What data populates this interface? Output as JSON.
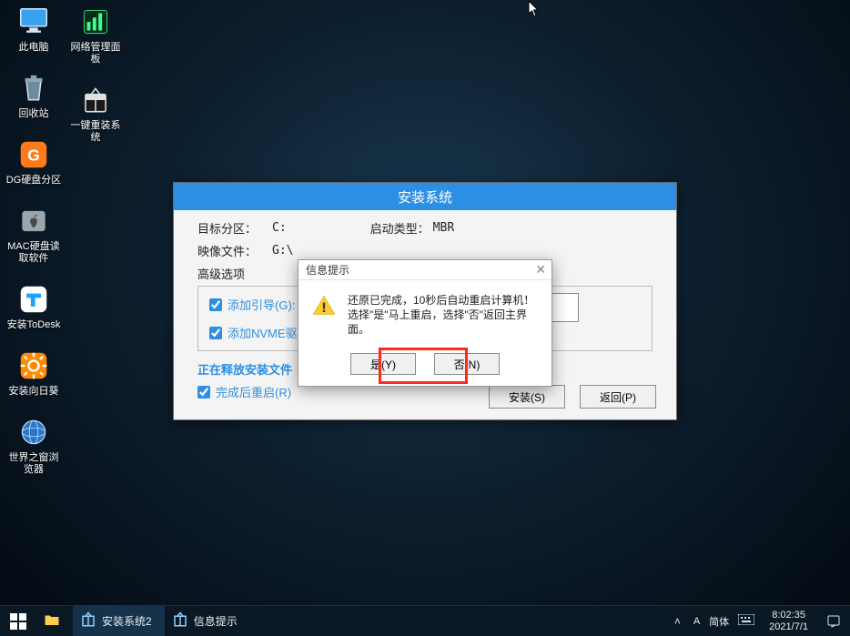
{
  "desktop": {
    "col1": [
      {
        "name": "this-pc",
        "label": "此电脑"
      },
      {
        "name": "recycle-bin",
        "label": "回收站"
      },
      {
        "name": "dg-partition",
        "label": "DG硬盘分区"
      },
      {
        "name": "mac-disk-reader",
        "label": "MAC硬盘读取软件"
      },
      {
        "name": "install-todesk",
        "label": "安装ToDesk"
      },
      {
        "name": "install-sunflower",
        "label": "安装向日葵"
      },
      {
        "name": "browser-world",
        "label": "世界之窗浏览器"
      }
    ],
    "col2": [
      {
        "name": "net-panel",
        "label": "网络管理面板"
      },
      {
        "name": "one-click-reinstall",
        "label": "一键重装系统"
      }
    ]
  },
  "installer": {
    "title": "安装系统",
    "target_label": "目标分区：",
    "target_value": "C:",
    "boot_label": "启动类型：",
    "boot_value": "MBR",
    "image_label": "映像文件：",
    "image_value": "G:\\",
    "advanced_label": "高级选项",
    "check_boot": "添加引导(G):",
    "check_nvme": "添加NVME驱",
    "progress": "正在释放安装文件",
    "check_restart": "完成后重启(R)",
    "btn_install": "安装(S)",
    "btn_back": "返回(P)"
  },
  "modal": {
    "title": "信息提示",
    "line1": "还原已完成，10秒后自动重启计算机！",
    "line2": "选择\"是\"马上重启，选择\"否\"返回主界面。",
    "btn_yes": "是(Y)",
    "btn_no": "否(N)"
  },
  "taskbar": {
    "items": [
      {
        "name": "install-system-2",
        "label": "安装系统2"
      },
      {
        "name": "info-prompt",
        "label": "信息提示"
      }
    ],
    "ime_a": "A",
    "ime_lang": "简体",
    "clock_time": "8:02:35",
    "clock_date": "2021/7/1"
  }
}
